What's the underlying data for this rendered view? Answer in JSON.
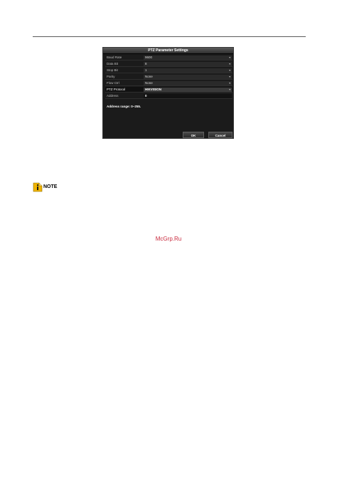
{
  "dialog": {
    "title": "PTZ Parameter Settings",
    "rows": [
      {
        "label": "Baud Rate",
        "value": "9600"
      },
      {
        "label": "Data Bit",
        "value": "8"
      },
      {
        "label": "Stop Bit",
        "value": "1"
      },
      {
        "label": "Parity",
        "value": "None"
      },
      {
        "label": "Flow Ctrl",
        "value": "None"
      },
      {
        "label": "PTZ Protocol",
        "value": "HIKVISION"
      },
      {
        "label": "Address",
        "value": "0"
      }
    ],
    "address_range": "Address range: 0~255.",
    "ok_label": "OK",
    "cancel_label": "Cancel"
  },
  "note": {
    "label": "NOTE"
  },
  "watermark": "McGrp.Ru",
  "colors": {
    "note_icon": "#f0b400",
    "watermark": "#c8283c"
  }
}
